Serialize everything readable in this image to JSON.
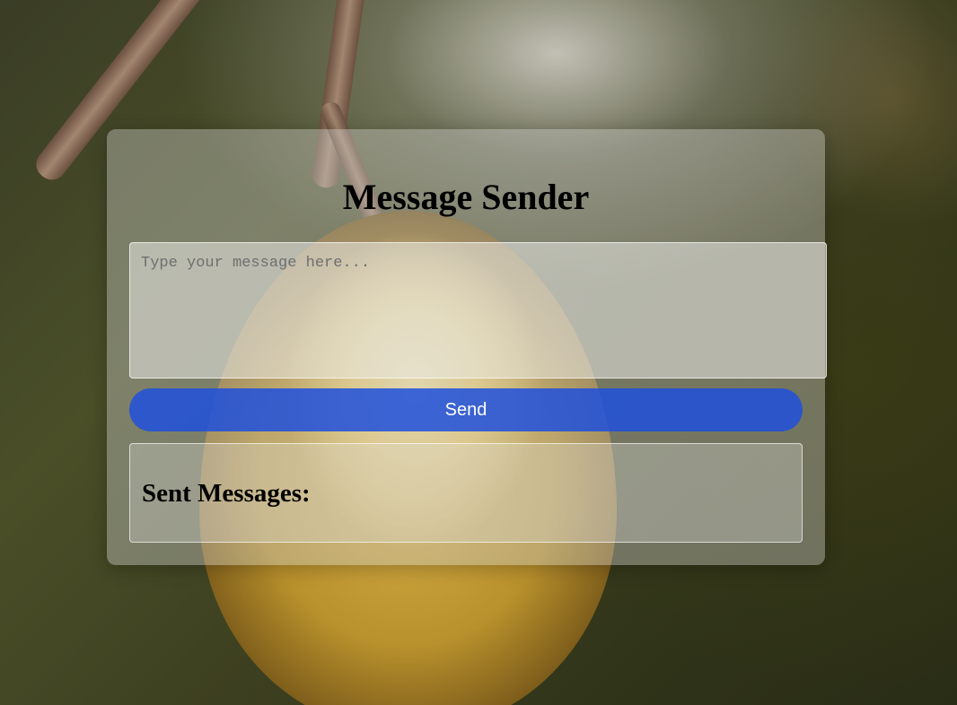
{
  "app": {
    "title": "Message Sender"
  },
  "composer": {
    "value": "",
    "placeholder": "Type your message here...",
    "send_label": "Send"
  },
  "sent": {
    "heading": "Sent Messages:",
    "messages": []
  },
  "colors": {
    "send_button": "#1e50dc",
    "send_text": "#ffffff"
  }
}
